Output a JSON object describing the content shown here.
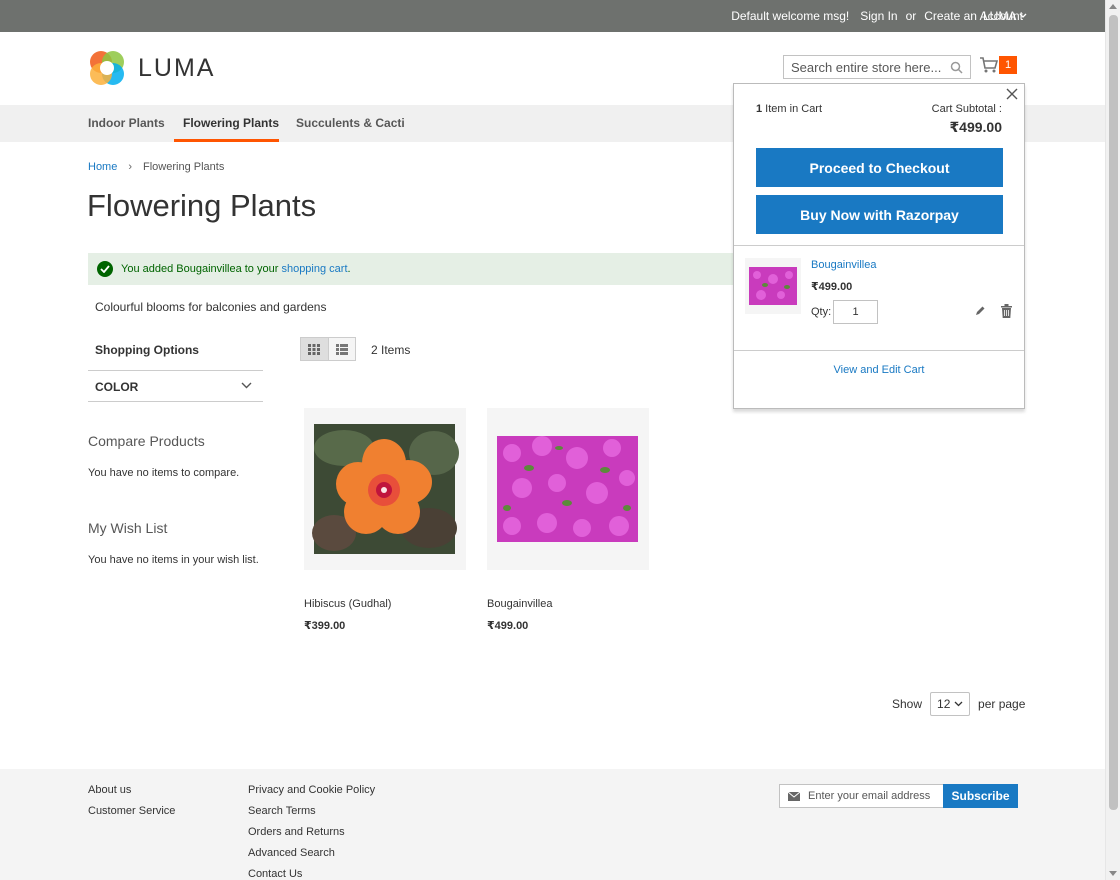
{
  "header": {
    "welcome": "Default welcome msg!",
    "sign_in": "Sign In",
    "or": "or",
    "create_account": "Create an Account",
    "language": "LUMA",
    "logo_text": "LUMA",
    "search_placeholder": "Search entire store here...",
    "cart_count": "1"
  },
  "nav": {
    "items": [
      {
        "label": "Indoor Plants"
      },
      {
        "label": "Flowering Plants"
      },
      {
        "label": "Succulents & Cacti"
      }
    ]
  },
  "breadcrumb": {
    "home": "Home",
    "separator": "›",
    "current": "Flowering Plants"
  },
  "page": {
    "title": "Flowering Plants",
    "message_prefix": "You added Bougainvillea to your ",
    "message_link": "shopping cart",
    "message_suffix": ".",
    "description": "Colourful blooms for balconies and gardens"
  },
  "sidebar": {
    "shopping_options": "Shopping Options",
    "color_filter": "COLOR",
    "compare_title": "Compare Products",
    "compare_text": "You have no items to compare.",
    "wishlist_title": "My Wish List",
    "wishlist_text": "You have no items in your wish list."
  },
  "toolbar": {
    "amount": "2 Items",
    "show": "Show",
    "limit": "12",
    "per_page": "per page"
  },
  "products": [
    {
      "name": "Hibiscus (Gudhal)",
      "price": "₹399.00"
    },
    {
      "name": "Bougainvillea",
      "price": "₹499.00"
    }
  ],
  "minicart": {
    "items_count": "1",
    "items_label": " Item in Cart",
    "subtotal_label": "Cart Subtotal :",
    "subtotal_value": "₹499.00",
    "checkout_button": "Proceed to Checkout",
    "razorpay_button": "Buy Now with Razorpay",
    "item_name": "Bougainvillea",
    "item_price": "₹499.00",
    "qty_label": "Qty:",
    "qty_value": "1",
    "view_cart": "View and Edit Cart"
  },
  "footer": {
    "col1": [
      "About us",
      "Customer Service"
    ],
    "col2": [
      "Privacy and Cookie Policy",
      "Search Terms",
      "Orders and Returns",
      "Advanced Search",
      "Contact Us"
    ],
    "newsletter_placeholder": "Enter your email address",
    "subscribe": "Subscribe"
  },
  "colors": {
    "topbar": "#6e716e",
    "accent": "#ff5501",
    "link": "#1979c3",
    "success_bg": "#e5efe5",
    "success_text": "#006400"
  }
}
